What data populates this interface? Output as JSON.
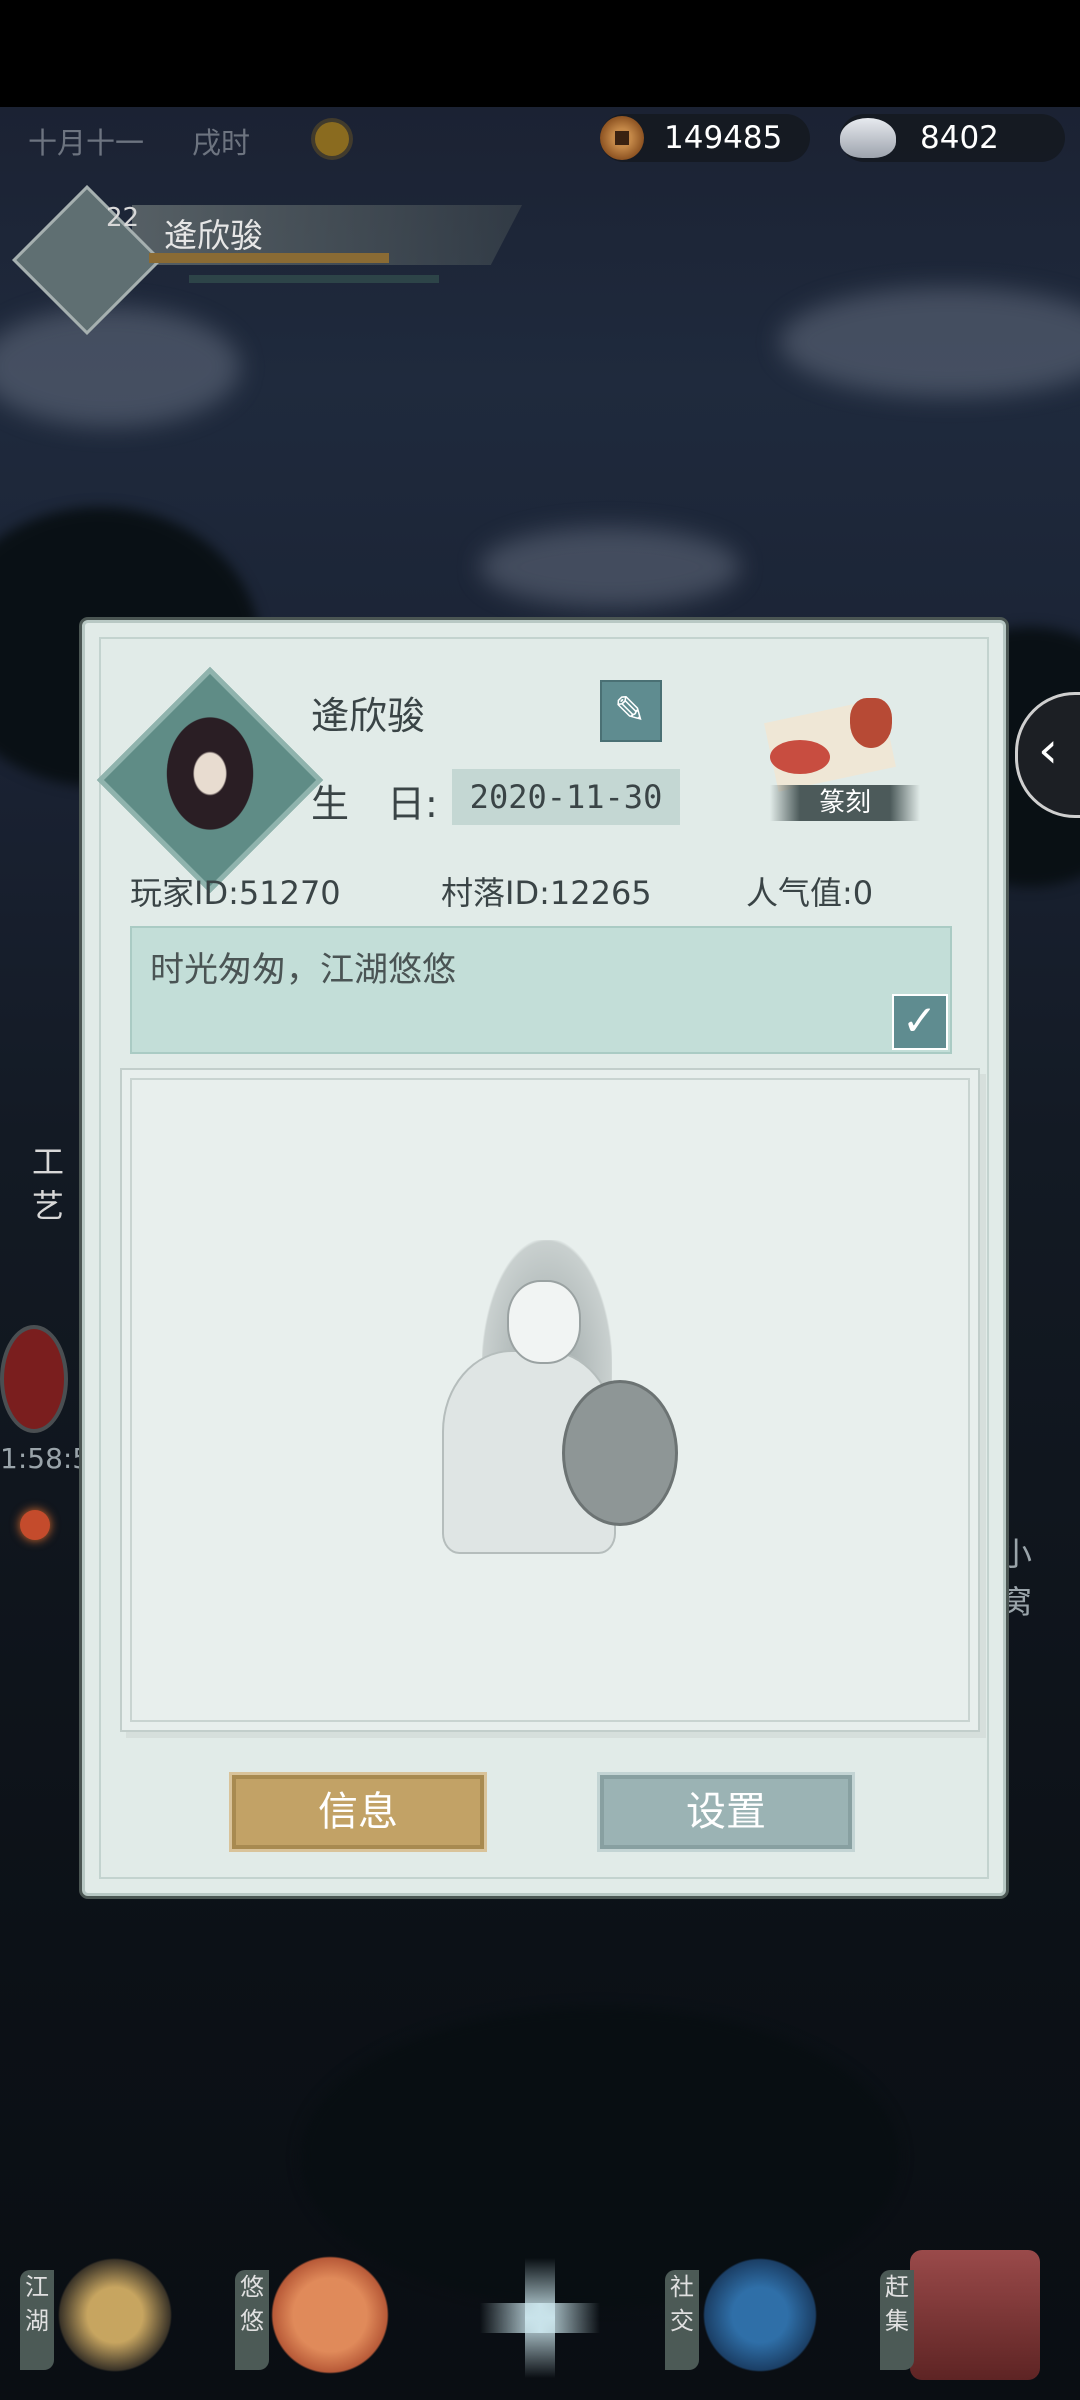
{
  "top_bar": {
    "date": "十月十一",
    "hour": "戌时",
    "copper_amount": "149485",
    "silver_amount": "8402"
  },
  "player": {
    "level": "22",
    "name": "逄欣骏"
  },
  "profile": {
    "name": "逄欣骏",
    "birthday_label": "生　日:",
    "birthday_value": "2020-11-30",
    "engrave_label": "篆刻",
    "player_id": "玩家ID:51270",
    "village_id": "村落ID:12265",
    "popularity": "人气值:0",
    "signature": "时光匆匆，江湖悠悠",
    "info_button": "信息",
    "settings_button": "设置"
  },
  "side": {
    "left_label": "工艺",
    "timer": "1:58:5",
    "right_label": "小窝"
  },
  "bottom_nav": [
    {
      "label": "江湖"
    },
    {
      "label": "悠悠"
    },
    {
      "label": "社交"
    },
    {
      "label": "赶集"
    }
  ],
  "icons": {
    "sun": "sun-icon",
    "copper": "copper-coin-icon",
    "silver": "silver-ingot-icon",
    "edit": "pencil-icon",
    "check": "check-icon",
    "collapse": "chevron-left-icon"
  }
}
